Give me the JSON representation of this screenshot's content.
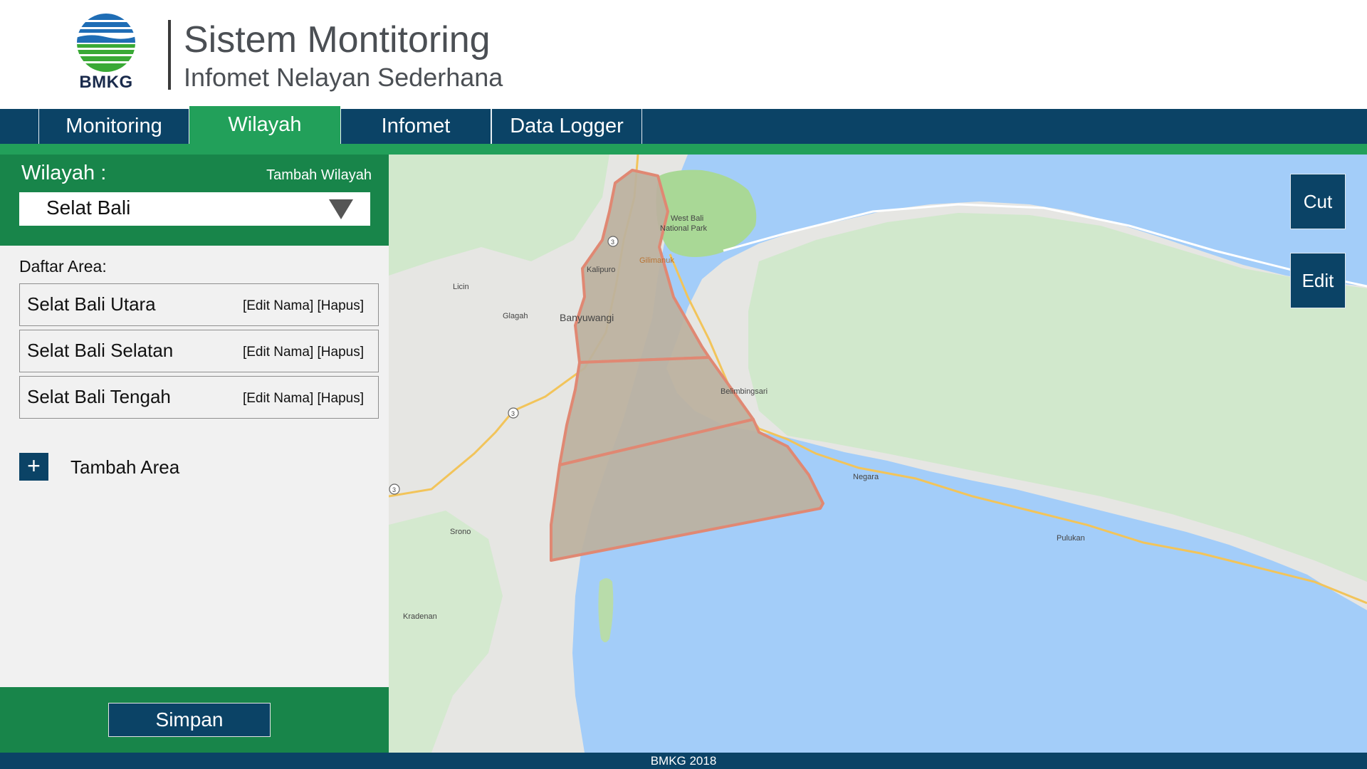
{
  "header": {
    "logo_text": "BMKG",
    "title": "Sistem Montitoring",
    "subtitle": "Infomet Nelayan Sederhana"
  },
  "nav": {
    "tabs": [
      {
        "label": "Monitoring",
        "active": false
      },
      {
        "label": "Wilayah",
        "active": true
      },
      {
        "label": "Infomet",
        "active": false
      },
      {
        "label": "Data Logger",
        "active": false
      }
    ]
  },
  "sidebar": {
    "wilayah_label": "Wilayah :",
    "tambah_wilayah": "Tambah Wilayah",
    "selected_wilayah": "Selat Bali",
    "daftar_label": "Daftar Area:",
    "areas": [
      {
        "name": "Selat Bali Utara",
        "edit": "[Edit Nama]",
        "delete": "[Hapus]"
      },
      {
        "name": "Selat Bali Selatan",
        "edit": "[Edit Nama]",
        "delete": "[Hapus]"
      },
      {
        "name": "Selat Bali Tengah",
        "edit": "[Edit Nama]",
        "delete": "[Hapus]"
      }
    ],
    "add_area_icon": "+",
    "add_area_label": "Tambah Area",
    "save_label": "Simpan"
  },
  "map": {
    "cut_label": "Cut",
    "edit_label": "Edit",
    "labels": {
      "park": [
        "West Bali",
        "National Park"
      ],
      "gilimanuk": "Gilimanuk",
      "kalipuro": "Kalipuro",
      "licin": "Licin",
      "glagah": "Glagah",
      "banyuwangi": "Banyuwangi",
      "belimbingsari": "Belimbingsari",
      "negara": "Negara",
      "srono": "Srono",
      "kradenan": "Kradenan",
      "pulukan": "Pulukan",
      "route_3": "3"
    },
    "colors": {
      "sea": "#a3cdf9",
      "land": "#e6e6e3",
      "green_land": "#d1e8cc",
      "park": "#a9d896",
      "polygon_fill": "#bcb19e",
      "polygon_stroke": "#e08873"
    }
  },
  "footer": {
    "text": "BMKG 2018"
  },
  "colors": {
    "navy": "#0b4366",
    "green": "#22a05a",
    "dark_green": "#18854a"
  }
}
